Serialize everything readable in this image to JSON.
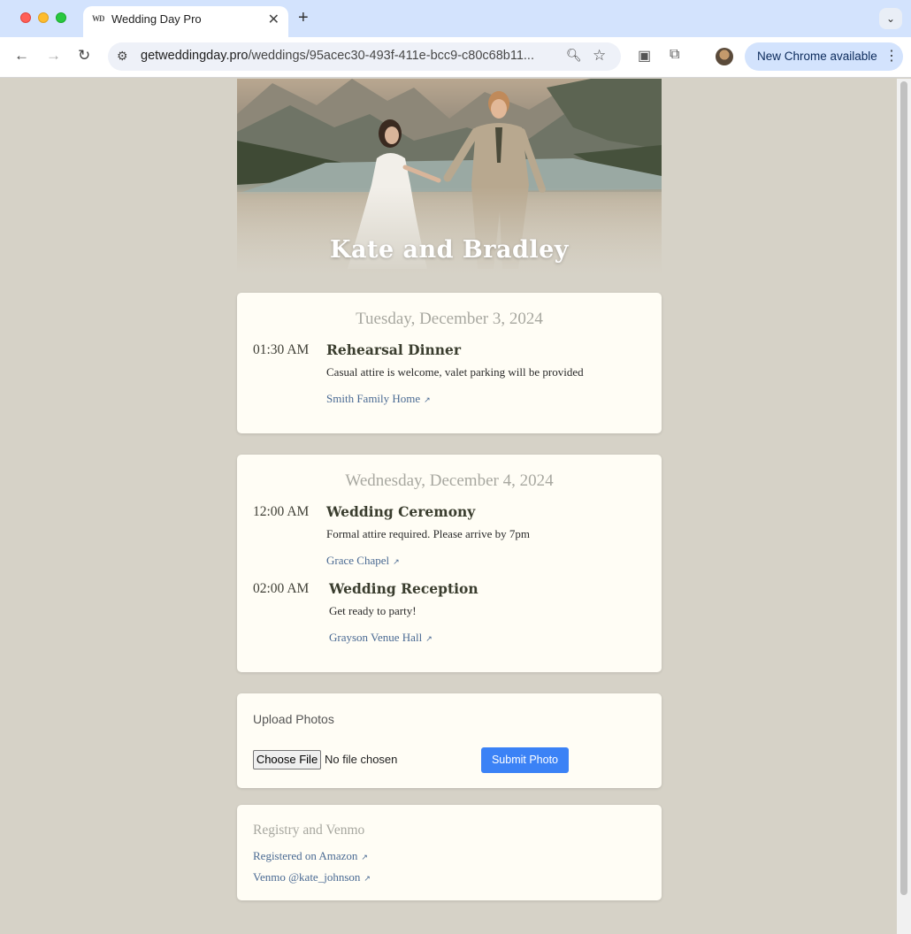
{
  "browser": {
    "tab_title": "Wedding Day Pro",
    "tab_favicon": "WD",
    "url_host": "getweddingday.pro",
    "url_path": "/weddings/95acec30-493f-411e-bcc9-c80c68b11...",
    "update_label": "New Chrome available"
  },
  "hero": {
    "title": "Kate and Bradley"
  },
  "days": [
    {
      "date": "Tuesday, December 3, 2024",
      "events": [
        {
          "time": "01:30 AM",
          "name": "Rehearsal Dinner",
          "description": "Casual attire is welcome, valet parking will be provided",
          "location": "Smith Family Home"
        }
      ]
    },
    {
      "date": "Wednesday, December 4, 2024",
      "events": [
        {
          "time": "12:00 AM",
          "name": "Wedding Ceremony",
          "description": "Formal attire required. Please arrive by 7pm",
          "location": "Grace Chapel"
        },
        {
          "time": "02:00 AM",
          "name": "Wedding Reception",
          "description": "Get ready to party!",
          "location": "Grayson Venue Hall"
        }
      ]
    }
  ],
  "upload": {
    "title": "Upload Photos",
    "choose_label": "Choose File",
    "no_file": "No file chosen",
    "submit_label": "Submit Photo"
  },
  "registry": {
    "title": "Registry and Venmo",
    "links": [
      "Registered on Amazon",
      "Venmo @kate_johnson"
    ]
  },
  "colors": {
    "page_bg": "#d6d2c7",
    "card_bg": "#fffdf5",
    "link": "#4a6a93",
    "submit": "#3b82f6"
  },
  "icons": {
    "external": "external-link-icon"
  }
}
